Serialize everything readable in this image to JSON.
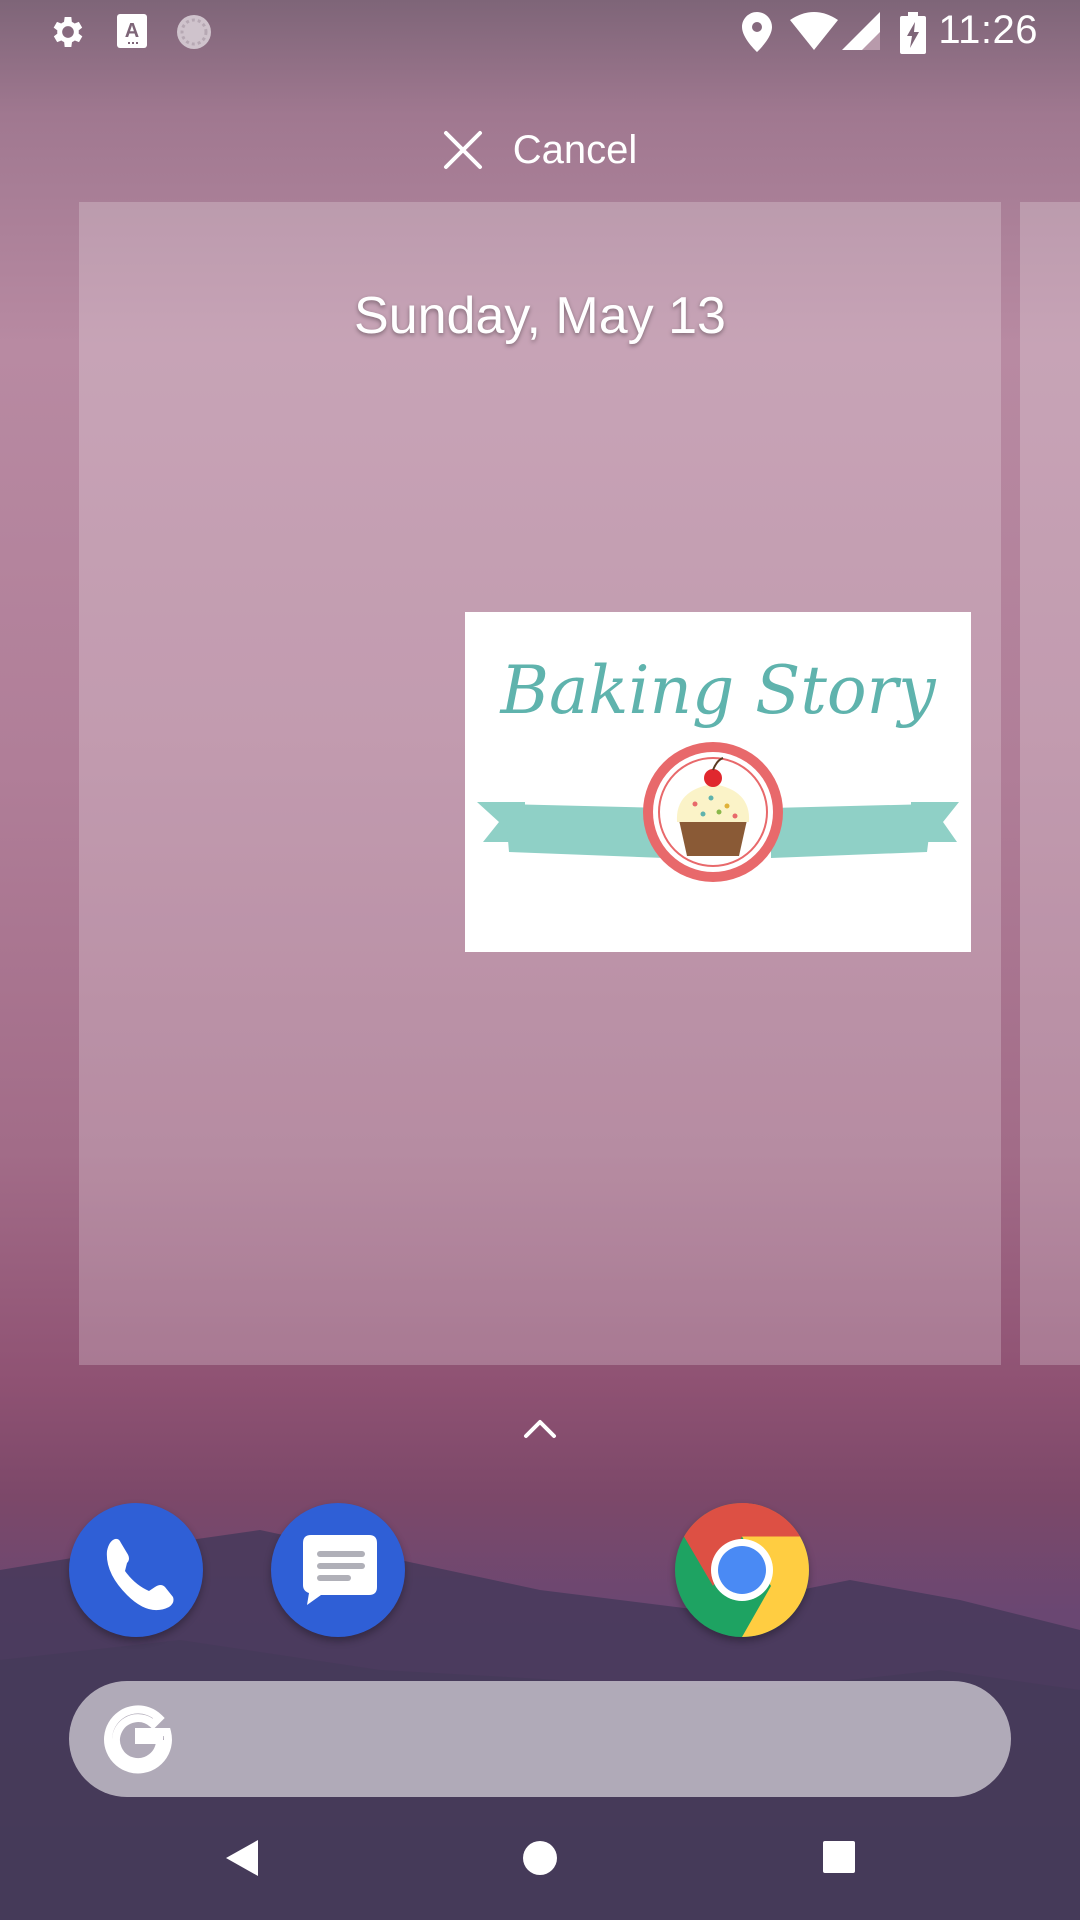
{
  "status_bar": {
    "time": "11:26",
    "left_icons": [
      "settings-icon",
      "keyboard-a-icon",
      "loading-icon"
    ],
    "right_icons": [
      "location-icon",
      "wifi-icon",
      "signal-icon",
      "battery-charging-icon"
    ]
  },
  "cancel_bar": {
    "label": "Cancel",
    "icon": "close-icon"
  },
  "workspace": {
    "date": "Sunday, May 13"
  },
  "widget": {
    "title": "Baking Story",
    "colors": {
      "title": "#5fb3ad",
      "ribbon": "#8fd0c6",
      "badge_border": "#e8696b",
      "frosting": "#fbf3c8",
      "cupcake_base": "#8a5a36",
      "cherry": "#e0282e"
    }
  },
  "dock": {
    "apps": [
      "phone",
      "messages",
      "chrome"
    ]
  },
  "search": {
    "icon": "google-g-icon"
  },
  "nav_bar": {
    "buttons": [
      "back",
      "home",
      "recents"
    ]
  }
}
